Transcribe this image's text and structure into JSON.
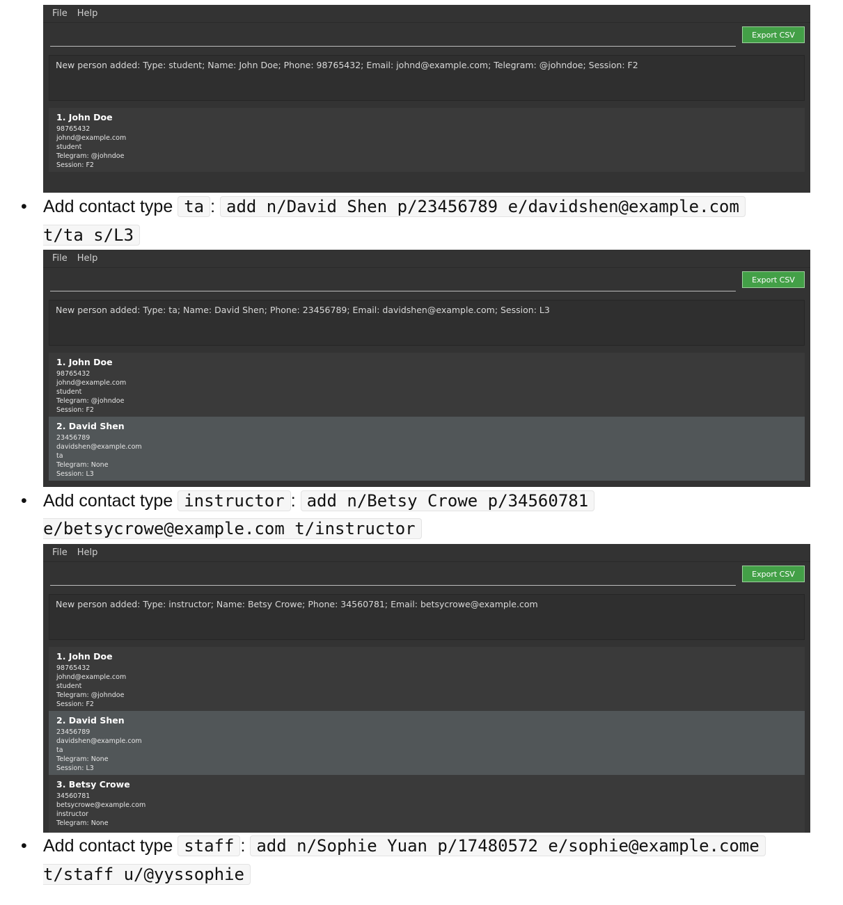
{
  "menu": {
    "file": "File",
    "help": "Help"
  },
  "export_label": "Export CSV",
  "shots": [
    {
      "result": "New person added: Type: student; Name: John Doe; Phone: 98765432; Email: johnd@example.com; Telegram: @johndoe; Session: F2",
      "persons": [
        {
          "name": "1.  John Doe",
          "lines": [
            "98765432",
            "johnd@example.com",
            "student",
            "Telegram: @johndoe",
            "Session: F2"
          ]
        }
      ]
    },
    {
      "result": "New person added: Type: ta; Name: David Shen; Phone: 23456789; Email: davidshen@example.com; Session: L3",
      "persons": [
        {
          "name": "1.  John Doe",
          "lines": [
            "98765432",
            "johnd@example.com",
            "student",
            "Telegram: @johndoe",
            "Session: F2"
          ]
        },
        {
          "name": "2.  David Shen",
          "lines": [
            "23456789",
            "davidshen@example.com",
            "ta",
            "Telegram: None",
            "Session: L3"
          ]
        }
      ]
    },
    {
      "result": "New person added: Type: instructor; Name: Betsy Crowe; Phone: 34560781; Email: betsycrowe@example.com",
      "persons": [
        {
          "name": "1.  John Doe",
          "lines": [
            "98765432",
            "johnd@example.com",
            "student",
            "Telegram: @johndoe",
            "Session: F2"
          ]
        },
        {
          "name": "2.  David Shen",
          "lines": [
            "23456789",
            "davidshen@example.com",
            "ta",
            "Telegram: None",
            "Session: L3"
          ]
        },
        {
          "name": "3.  Betsy Crowe",
          "lines": [
            "34560781",
            "betsycrowe@example.com",
            "instructor",
            "Telegram: None"
          ]
        }
      ]
    }
  ],
  "bullets": [
    {
      "prefix": "Add contact type",
      "type": "ta",
      "sep": ":",
      "cmd1": "add n/David Shen p/23456789 e/davidshen@example.com",
      "cmd2": "t/ta s/L3"
    },
    {
      "prefix": "Add contact type",
      "type": "instructor",
      "sep": ":",
      "cmd1": "add n/Betsy Crowe p/34560781",
      "cmd2": "e/betsycrowe@example.com t/instructor"
    },
    {
      "prefix": "Add contact type",
      "type": "staff",
      "sep": ":",
      "cmd1": "add n/Sophie Yuan p/17480572 e/sophie@example.come",
      "cmd2": "t/staff u/@yyssophie"
    }
  ]
}
